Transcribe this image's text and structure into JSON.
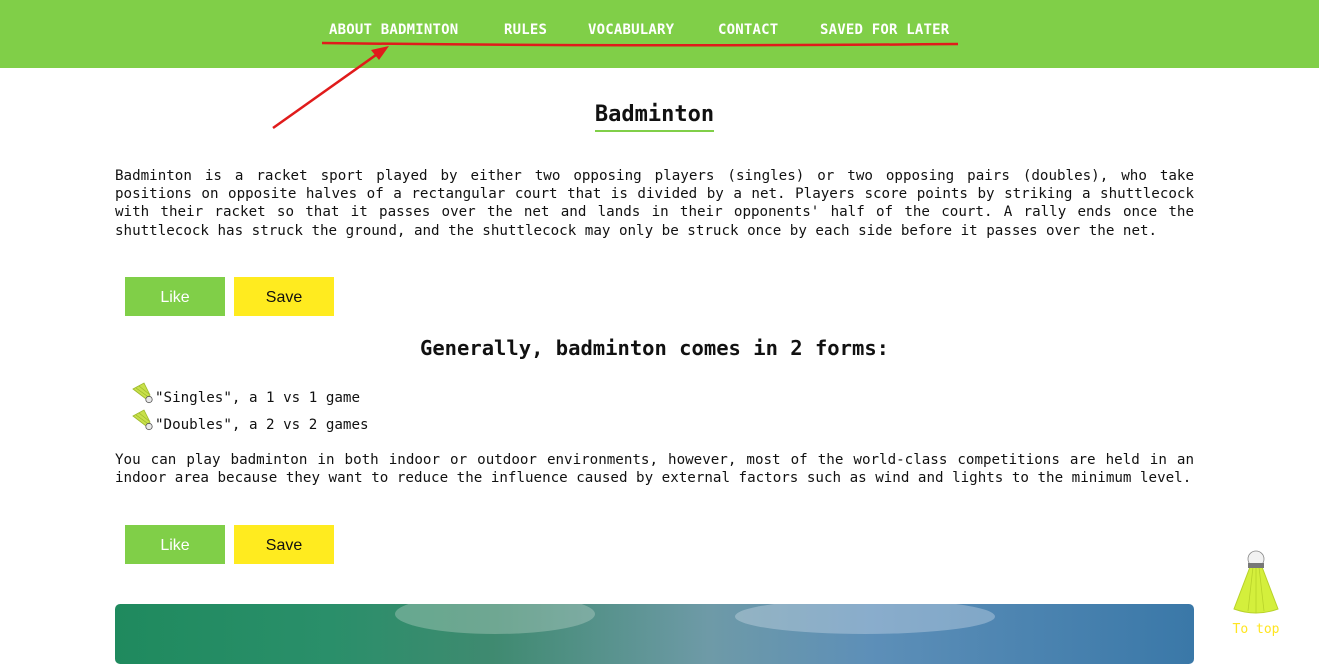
{
  "nav": {
    "items": [
      {
        "label": "ABOUT BADMINTON"
      },
      {
        "label": "RULES"
      },
      {
        "label": "VOCABULARY"
      },
      {
        "label": "CONTACT"
      },
      {
        "label": "SAVED FOR LATER"
      }
    ]
  },
  "main": {
    "title": "Badminton",
    "intro": "Badminton is a racket sport played by either two opposing players (singles) or two opposing pairs (doubles), who take positions on opposite halves of a rectangular court that is divided by a net. Players score points by striking a shuttlecock with their racket so that it passes over the net and lands in their opponents' half of the court. A rally ends once the shuttlecock has struck the ground, and the shuttlecock may only be struck once by each side before it passes over the net.",
    "like_label": "Like",
    "save_label": "Save",
    "forms_heading": "Generally, badminton comes in 2 forms:",
    "forms": [
      "\"Singles\", a 1 vs 1 game",
      "\"Doubles\", a 2 vs 2 games"
    ],
    "environment": "You can play badminton in both indoor or outdoor environments, however, most of the world-class competitions are held in an indoor area because they want to reduce the influence caused by external factors such as wind and lights to the minimum level."
  },
  "to_top": {
    "label": "To top"
  },
  "colors": {
    "accent_green": "#80cf48",
    "save_yellow": "#ffeb1f",
    "annotation_red": "#e01b1b"
  }
}
